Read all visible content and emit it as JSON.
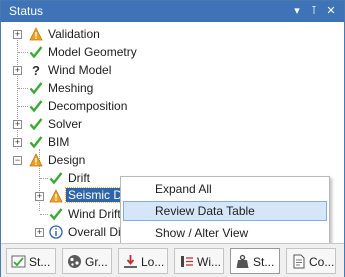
{
  "window": {
    "title": "Status",
    "buttons": {
      "dropdown": "▾",
      "pin": "⊺",
      "close": "✕"
    }
  },
  "tree": {
    "nodes": [
      {
        "label": "Validation",
        "status": "warning",
        "expander": "+"
      },
      {
        "label": "Model Geometry",
        "status": "ok"
      },
      {
        "label": "Wind Model",
        "status": "unknown",
        "expander": "+"
      },
      {
        "label": "Meshing",
        "status": "ok"
      },
      {
        "label": "Decomposition",
        "status": "ok"
      },
      {
        "label": "Solver",
        "status": "ok",
        "expander": "+"
      },
      {
        "label": "BIM",
        "status": "ok",
        "expander": "+"
      },
      {
        "label": "Design",
        "status": "warning",
        "expander": "−"
      },
      {
        "label": "Drift",
        "status": "ok"
      },
      {
        "label": "Seismic Dri",
        "status": "warning",
        "expander": "+",
        "selected": true
      },
      {
        "label": "Wind Drift",
        "status": "ok"
      },
      {
        "label": "Overall Dis",
        "status": "info",
        "expander": "+"
      }
    ]
  },
  "context_menu": {
    "items": [
      {
        "label": "Expand All"
      },
      {
        "label": "Review Data Table",
        "hover": true
      },
      {
        "label": "Show / Alter View"
      }
    ]
  },
  "tabs": [
    {
      "label": "St...",
      "icon": "status-icon"
    },
    {
      "label": "Gr...",
      "icon": "globe-icon"
    },
    {
      "label": "Lo...",
      "icon": "load-icon"
    },
    {
      "label": "Wi...",
      "icon": "wind-icon"
    },
    {
      "label": "St...",
      "icon": "weight-icon",
      "active": true
    },
    {
      "label": "Co...",
      "icon": "document-icon"
    }
  ],
  "colors": {
    "titlebar": "#3e74b7",
    "selection": "#2e64a8",
    "check_green": "#3aa935",
    "warning_orange": "#f0a020",
    "menu_hover": "#d5e6f8"
  }
}
